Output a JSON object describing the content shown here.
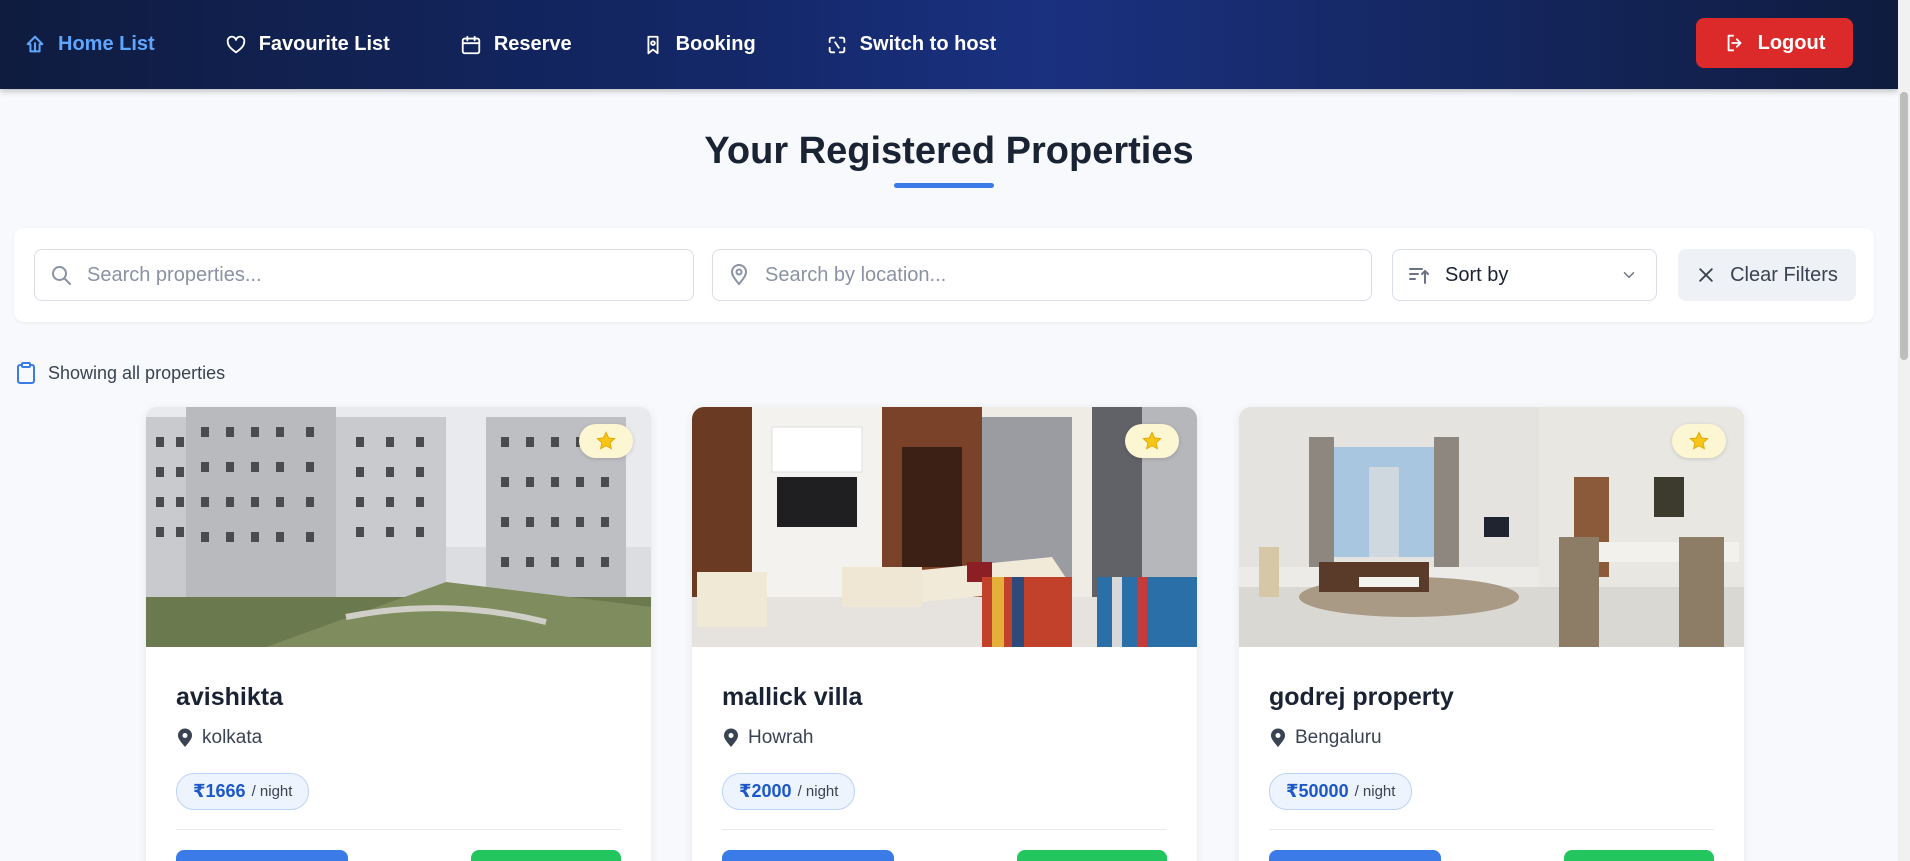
{
  "nav": {
    "items": [
      {
        "label": "Home List",
        "icon": "home-icon",
        "active": true
      },
      {
        "label": "Favourite List",
        "icon": "heart-icon",
        "active": false
      },
      {
        "label": "Reserve",
        "icon": "calendar-icon",
        "active": false
      },
      {
        "label": "Booking",
        "icon": "bookmark-icon",
        "active": false
      },
      {
        "label": "Switch to host",
        "icon": "switch-icon",
        "active": false
      }
    ],
    "logout_label": "Logout"
  },
  "page": {
    "title": "Your Registered Properties",
    "showing_text": "Showing all properties"
  },
  "filters": {
    "search_placeholder": "Search properties...",
    "location_placeholder": "Search by location...",
    "sort_label": "Sort by",
    "clear_label": "Clear Filters"
  },
  "properties": [
    {
      "name": "avishikta",
      "location": "kolkata",
      "price": "₹1666",
      "unit": "/ night"
    },
    {
      "name": "mallick villa",
      "location": "Howrah",
      "price": "₹2000",
      "unit": "/ night"
    },
    {
      "name": "godrej property",
      "location": "Bengaluru",
      "price": "₹50000",
      "unit": "/ night"
    }
  ],
  "colors": {
    "accent": "#3b7be8",
    "logout": "#dc2a2a",
    "active_nav": "#5fa6ff",
    "star": "#f5c518",
    "green_button": "#22c55e"
  }
}
